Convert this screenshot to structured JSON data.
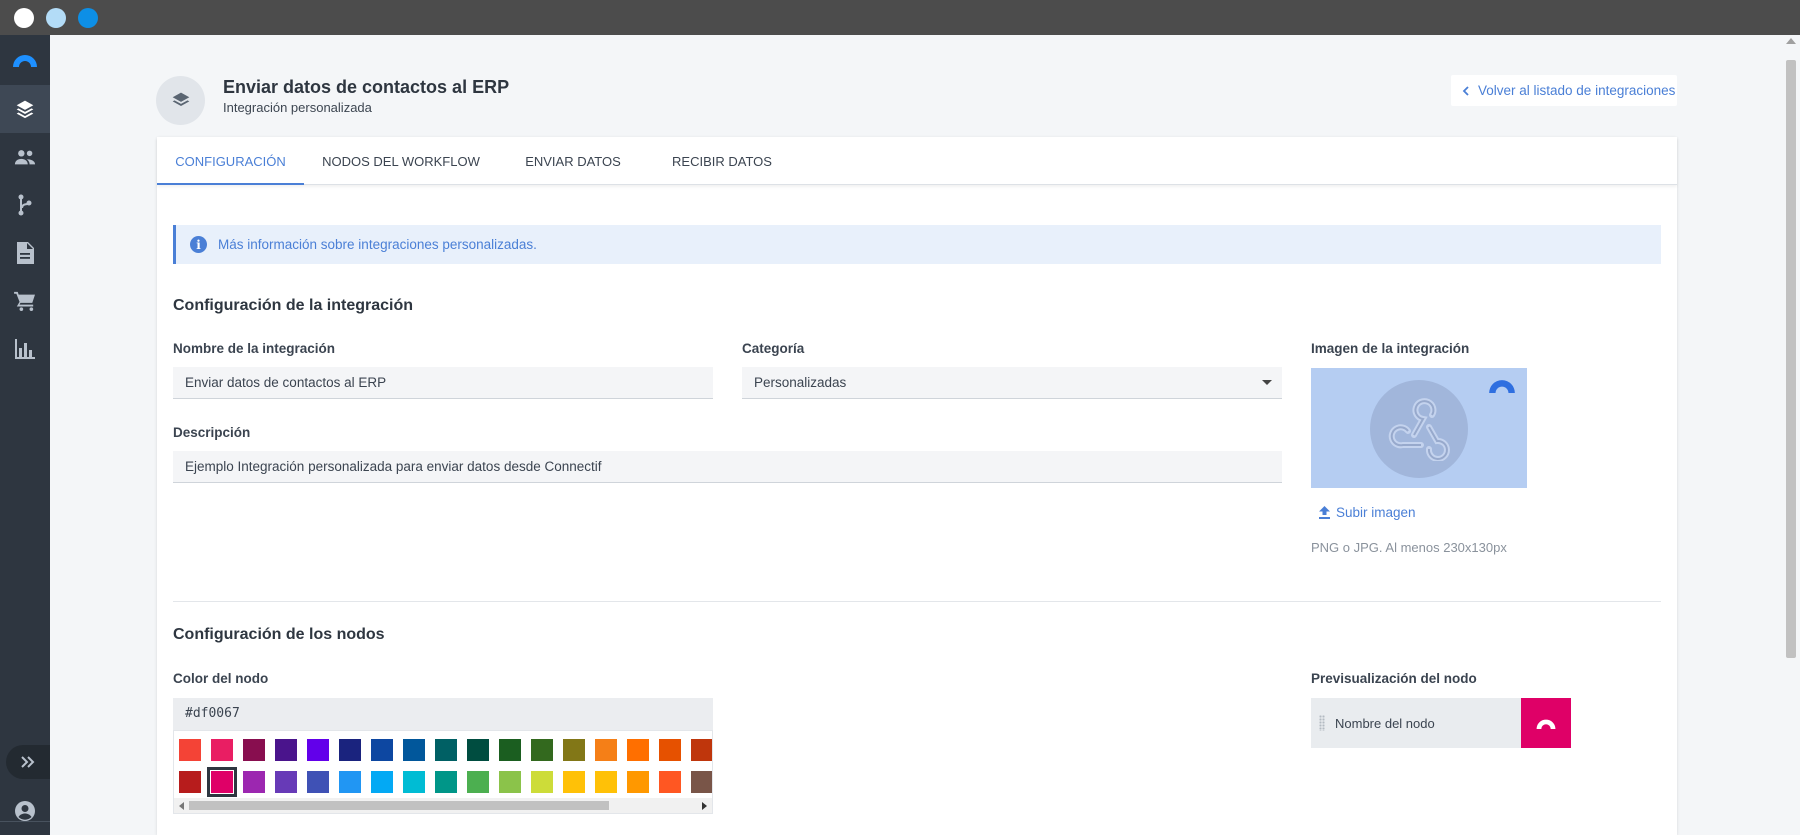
{
  "window": {
    "dot_colors": [
      "#ffffff",
      "#b3dcf7",
      "#0d8fe6"
    ]
  },
  "sidebar": {
    "items": [
      {
        "icon": "brand-logo-icon"
      },
      {
        "icon": "layers-icon",
        "active": true
      },
      {
        "icon": "contacts-icon"
      },
      {
        "icon": "workflow-branch-icon"
      },
      {
        "icon": "document-icon"
      },
      {
        "icon": "shopping-cart-icon"
      },
      {
        "icon": "bar-chart-icon"
      }
    ],
    "expand_icon": "double-chevron-right-icon",
    "profile_icon": "user-account-icon"
  },
  "header": {
    "title": "Enviar datos de contactos al ERP",
    "subtitle": "Integración personalizada",
    "icon": "layers-icon",
    "back_label": "Volver al listado de integraciones"
  },
  "tabs": [
    {
      "label": "CONFIGURACIÓN",
      "active": true
    },
    {
      "label": "NODOS DEL WORKFLOW",
      "active": false
    },
    {
      "label": "ENVIAR DATOS",
      "active": false
    },
    {
      "label": "RECIBIR DATOS",
      "active": false
    }
  ],
  "info_banner": {
    "text": "Más información sobre integraciones personalizadas."
  },
  "integration_config": {
    "title": "Configuración de la integración",
    "name_label": "Nombre de la integración",
    "name_value": "Enviar datos de contactos al ERP",
    "category_label": "Categoría",
    "category_value": "Personalizadas",
    "description_label": "Descripción",
    "description_value": "Ejemplo Integración personalizada para enviar datos desde Connectif",
    "image_label": "Imagen de la integración",
    "upload_label": "Subir imagen",
    "image_hint": "PNG o JPG. Al menos 230x130px"
  },
  "node_config": {
    "title": "Configuración de los nodos",
    "color_label": "Color del nodo",
    "color_value": "#df0067",
    "palette_row1": [
      "#f44336",
      "#e91e63",
      "#880e4f",
      "#4a148c",
      "#6200ea",
      "#1a237e",
      "#0d47a1",
      "#01579b",
      "#006064",
      "#004d40",
      "#1b5e20",
      "#33691e",
      "#827717",
      "#f57f17",
      "#ff6f00",
      "#e65100",
      "#bf360c"
    ],
    "palette_row2": [
      "#b71c1c",
      "#df0067",
      "#9c27b0",
      "#673ab7",
      "#3f51b5",
      "#2196f3",
      "#03a9f4",
      "#00bcd4",
      "#009688",
      "#4caf50",
      "#8bc34a",
      "#cddc39",
      "#ffc107",
      "#ffc107",
      "#ff9800",
      "#ff5722",
      "#795548"
    ],
    "selected_color": "#df0067",
    "preview_label": "Previsualización del nodo",
    "preview_node_name": "Nombre del nodo"
  }
}
